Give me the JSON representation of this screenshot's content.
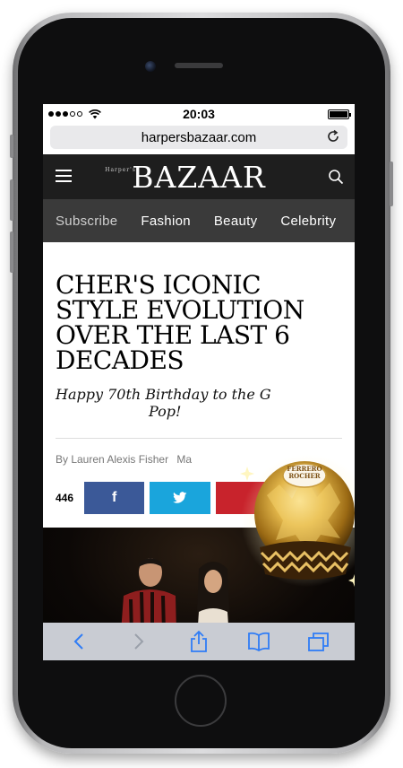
{
  "status_bar": {
    "time": "20:03",
    "signal_bars": 3,
    "signal_total": 5,
    "battery_level": 1.0
  },
  "browser": {
    "url": "harpersbazaar.com"
  },
  "site_header": {
    "logo": "BAZAAR",
    "logo_prefix": "Harper's"
  },
  "categories": [
    "Subscribe",
    "Fashion",
    "Beauty",
    "Celebrity"
  ],
  "article": {
    "headline": "CHER'S ICONIC STYLE EVOLUTION OVER THE LAST 6 DECADES",
    "dek": "Happy 70th Birthday to the G",
    "dek_end": "Pop!",
    "byline": "By Lauren Alexis Fisher",
    "byline_more": "Ma"
  },
  "share": {
    "count": "446",
    "facebook_label": "f"
  },
  "ad": {
    "brand_line1": "FERRERO",
    "brand_line2": "ROCHER"
  },
  "icons": {
    "menu": "hamburger-icon",
    "search": "search-icon",
    "reload": "reload-icon",
    "back": "chevron-left-icon",
    "forward": "chevron-right-icon",
    "share": "share-icon",
    "bookmarks": "book-icon",
    "tabs": "tabs-icon"
  },
  "colors": {
    "facebook": "#3b5998",
    "twitter": "#1aa5dc",
    "pinterest": "#c8232c",
    "mail": "#333333",
    "nav_bg": "#1e1e1e",
    "category_bg": "#3a3a3a"
  }
}
